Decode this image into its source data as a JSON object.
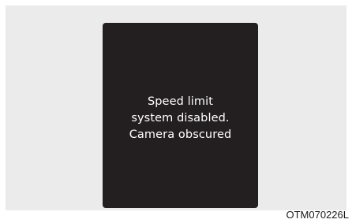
{
  "display": {
    "message_lines": [
      "Speed limit",
      "system disabled.",
      "Camera obscured"
    ],
    "background_color": "#231f20",
    "text_color": "#ffffff"
  },
  "panel": {
    "background_color": "#ebebeb"
  },
  "figure_code": "OTM070226L"
}
